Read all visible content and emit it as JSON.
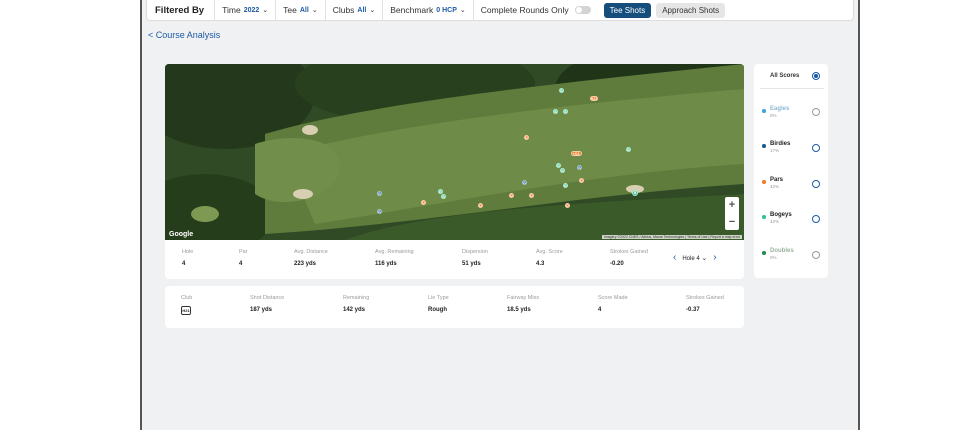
{
  "filters": {
    "title": "Filtered By",
    "time_label": "Time",
    "time_value": "2022",
    "tee_label": "Tee",
    "tee_value": "All",
    "clubs_label": "Clubs",
    "clubs_value": "All",
    "benchmark_label": "Benchmark",
    "benchmark_value": "0 HCP",
    "complete_rounds_label": "Complete Rounds Only",
    "complete_rounds_on": false,
    "tee_shots_label": "Tee Shots",
    "approach_shots_label": "Approach Shots"
  },
  "back_link": "< Course Analysis",
  "map": {
    "google_label": "Google",
    "attribution": "Imagery ©2022 CNES / Airbus, Maxar Technologies | Terms of Use | Report a map error",
    "zoom_in": "+",
    "zoom_out": "−",
    "colors": {
      "eagle": "#3fa4d6",
      "birdie": "#1c5a8a",
      "par": "#ef7f2a",
      "bogey": "#36c48d",
      "double": "#1f8e4f"
    }
  },
  "hole_stats": {
    "hole": {
      "label": "Hole",
      "value": "4"
    },
    "par": {
      "label": "Par",
      "value": "4"
    },
    "avg_distance": {
      "label": "Avg. Distance",
      "value": "223 yds"
    },
    "avg_remaining": {
      "label": "Avg. Remaining",
      "value": "116 yds"
    },
    "dispersion": {
      "label": "Dispersion",
      "value": "51 yds"
    },
    "avg_score": {
      "label": "Avg. Score",
      "value": "4.3"
    },
    "strokes_gained": {
      "label": "Strokes Gained",
      "value": "-0.20"
    },
    "hole_select": "Hole 4"
  },
  "shot": {
    "club": {
      "label": "Club",
      "value": "H21"
    },
    "shot_distance": {
      "label": "Shot Distance",
      "value": "187 yds"
    },
    "remaining": {
      "label": "Remaining",
      "value": "142 yds"
    },
    "lie_type": {
      "label": "Lie Type",
      "value": "Rough"
    },
    "fairway_miss": {
      "label": "Fairway Miss",
      "value": "18.5 yds"
    },
    "score_made": {
      "label": "Score Made",
      "value": "4"
    },
    "strokes_gained": {
      "label": "Strokes Gained",
      "value": "-0.37"
    }
  },
  "legend": {
    "all_label": "All Scores",
    "items": [
      {
        "name": "Eagles",
        "pct": "0%",
        "color": "#3fa4d6",
        "dim": true
      },
      {
        "name": "Birdies",
        "pct": "17%",
        "color": "#1c5a8a",
        "dim": false
      },
      {
        "name": "Pars",
        "pct": "42%",
        "color": "#ef7f2a",
        "dim": false
      },
      {
        "name": "Bogeys",
        "pct": "42%",
        "color": "#36c48d",
        "dim": false
      },
      {
        "name": "Doubles",
        "pct": "0%",
        "color": "#1f8e4f",
        "dim": true
      }
    ]
  }
}
